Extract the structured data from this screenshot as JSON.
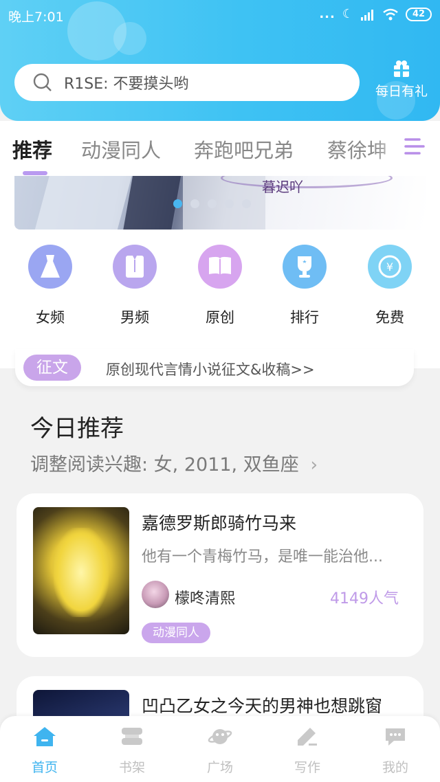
{
  "status_bar": {
    "time": "晚上7:01",
    "dots": "...",
    "battery": "42"
  },
  "search": {
    "placeholder": "R1SE: 不要摸头哟"
  },
  "gift": {
    "label": "每日有礼"
  },
  "tabs": [
    {
      "label": "推荐",
      "active": true
    },
    {
      "label": "动漫同人"
    },
    {
      "label": "奔跑吧兄弟"
    },
    {
      "label": "蔡徐坤"
    }
  ],
  "banner": {
    "title": "暮迟吖",
    "active_dot": 0
  },
  "categories": [
    {
      "label": "女频",
      "icon": "dress-icon",
      "color": "#9aa6f2"
    },
    {
      "label": "男频",
      "icon": "shirt-icon",
      "color": "#b9a6ee"
    },
    {
      "label": "原创",
      "icon": "book-icon",
      "color": "#d7a5ef"
    },
    {
      "label": "排行",
      "icon": "trophy-icon",
      "color": "#6fbdf4"
    },
    {
      "label": "免费",
      "icon": "coin-icon",
      "color": "#7fd3f5"
    }
  ],
  "notice": {
    "badge": "征文",
    "text": "原创现代言情小说征文&收稿>>"
  },
  "section": {
    "title": "今日推荐",
    "subtitle": "调整阅读兴趣: 女, 2011, 双鱼座",
    "chevron": "›"
  },
  "books": [
    {
      "title": "嘉德罗斯郎骑竹马来",
      "desc": "他有一个青梅竹马，是唯一能治他...",
      "author": "檬咚清熙",
      "popularity": "4149人气",
      "tag": "动漫同人"
    },
    {
      "title": "凹凸乙女之今天的男神也想跳窗"
    }
  ],
  "nav": [
    {
      "label": "首页",
      "icon": "home-icon",
      "active": true
    },
    {
      "label": "书架",
      "icon": "bookshelf-icon"
    },
    {
      "label": "广场",
      "icon": "planet-icon"
    },
    {
      "label": "写作",
      "icon": "pen-icon"
    },
    {
      "label": "我的",
      "icon": "chat-icon"
    }
  ],
  "colors": {
    "accent": "#3fb4ef",
    "purple": "#c9a5ea",
    "header": "#3ec2f3"
  }
}
